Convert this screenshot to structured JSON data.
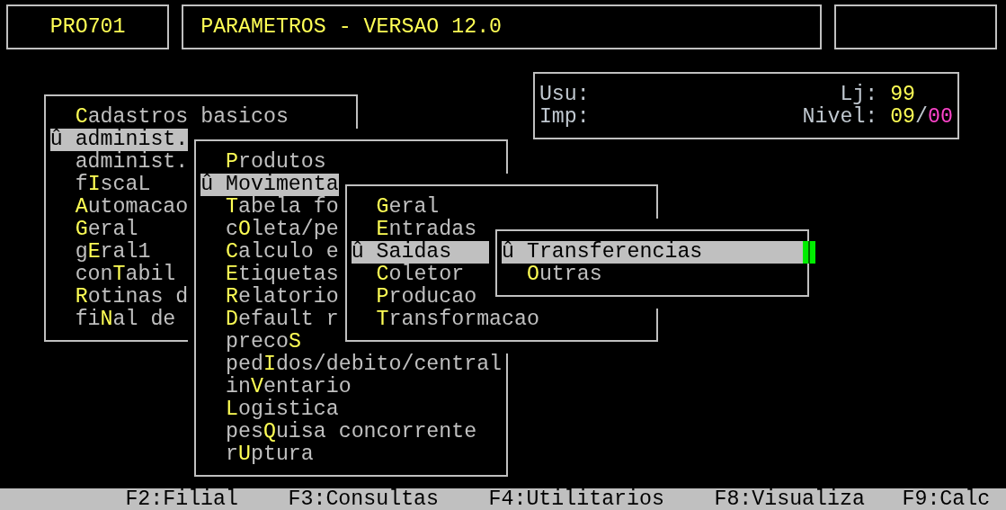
{
  "header": {
    "program_code": "PRO701",
    "title": "PARAMETROS - VERSAO 12.0"
  },
  "session_info": {
    "user_label": "Usu:",
    "printer_label": "Imp:",
    "store_label": "Lj:",
    "store_value": "99",
    "level_label": "Nivel:",
    "level_value": "09",
    "level_separator": "/",
    "level_max": "00"
  },
  "menus": [
    {
      "items": [
        {
          "label": "**C**adastros basicos",
          "selected": false
        },
        {
          "label": "administ.",
          "selected": true,
          "marker": "û"
        },
        {
          "label": "administ.",
          "selected": false
        },
        {
          "label": "f**I**scaL",
          "selected": false
        },
        {
          "label": "**A**utomacao",
          "selected": false
        },
        {
          "label": "**G**eral",
          "selected": false
        },
        {
          "label": "g**E**ral1",
          "selected": false
        },
        {
          "label": "con**T**abil",
          "selected": false
        },
        {
          "label": "**R**otinas d",
          "selected": false
        },
        {
          "label": "fi**N**al de",
          "selected": false
        }
      ]
    },
    {
      "items": [
        {
          "label": "**P**rodutos",
          "selected": false
        },
        {
          "label": "Movimenta",
          "selected": true,
          "marker": "û"
        },
        {
          "label": "**T**abela fo",
          "selected": false
        },
        {
          "label": "c**O**leta/pe",
          "selected": false
        },
        {
          "label": "**C**alculo e",
          "selected": false
        },
        {
          "label": "**E**tiquetas",
          "selected": false
        },
        {
          "label": "**R**elatorio",
          "selected": false
        },
        {
          "label": "**D**efault r",
          "selected": false
        },
        {
          "label": "preco**S**",
          "selected": false
        },
        {
          "label": "ped**I**dos/debito/central",
          "selected": false
        },
        {
          "label": "in**V**entario",
          "selected": false
        },
        {
          "label": "**L**ogistica",
          "selected": false
        },
        {
          "label": "pes**Q**uisa concorrente",
          "selected": false
        },
        {
          "label": "r**U**ptura",
          "selected": false
        }
      ]
    },
    {
      "items": [
        {
          "label": "**G**eral",
          "selected": false
        },
        {
          "label": "**E**ntradas",
          "selected": false
        },
        {
          "label": "Saidas",
          "selected": true,
          "marker": "û"
        },
        {
          "label": "**C**oletor",
          "selected": false
        },
        {
          "label": "**P**roducao",
          "selected": false
        },
        {
          "label": "**T**ransformacao",
          "selected": false
        }
      ]
    },
    {
      "items": [
        {
          "label": "Transferencias",
          "selected": true,
          "marker": "û"
        },
        {
          "label": "**O**utras",
          "selected": false
        }
      ]
    }
  ],
  "function_keys": [
    "F2:Filial",
    "F3:Consultas",
    "F4:Utilitarios",
    "F8:Visualiza",
    "F9:Calc"
  ]
}
